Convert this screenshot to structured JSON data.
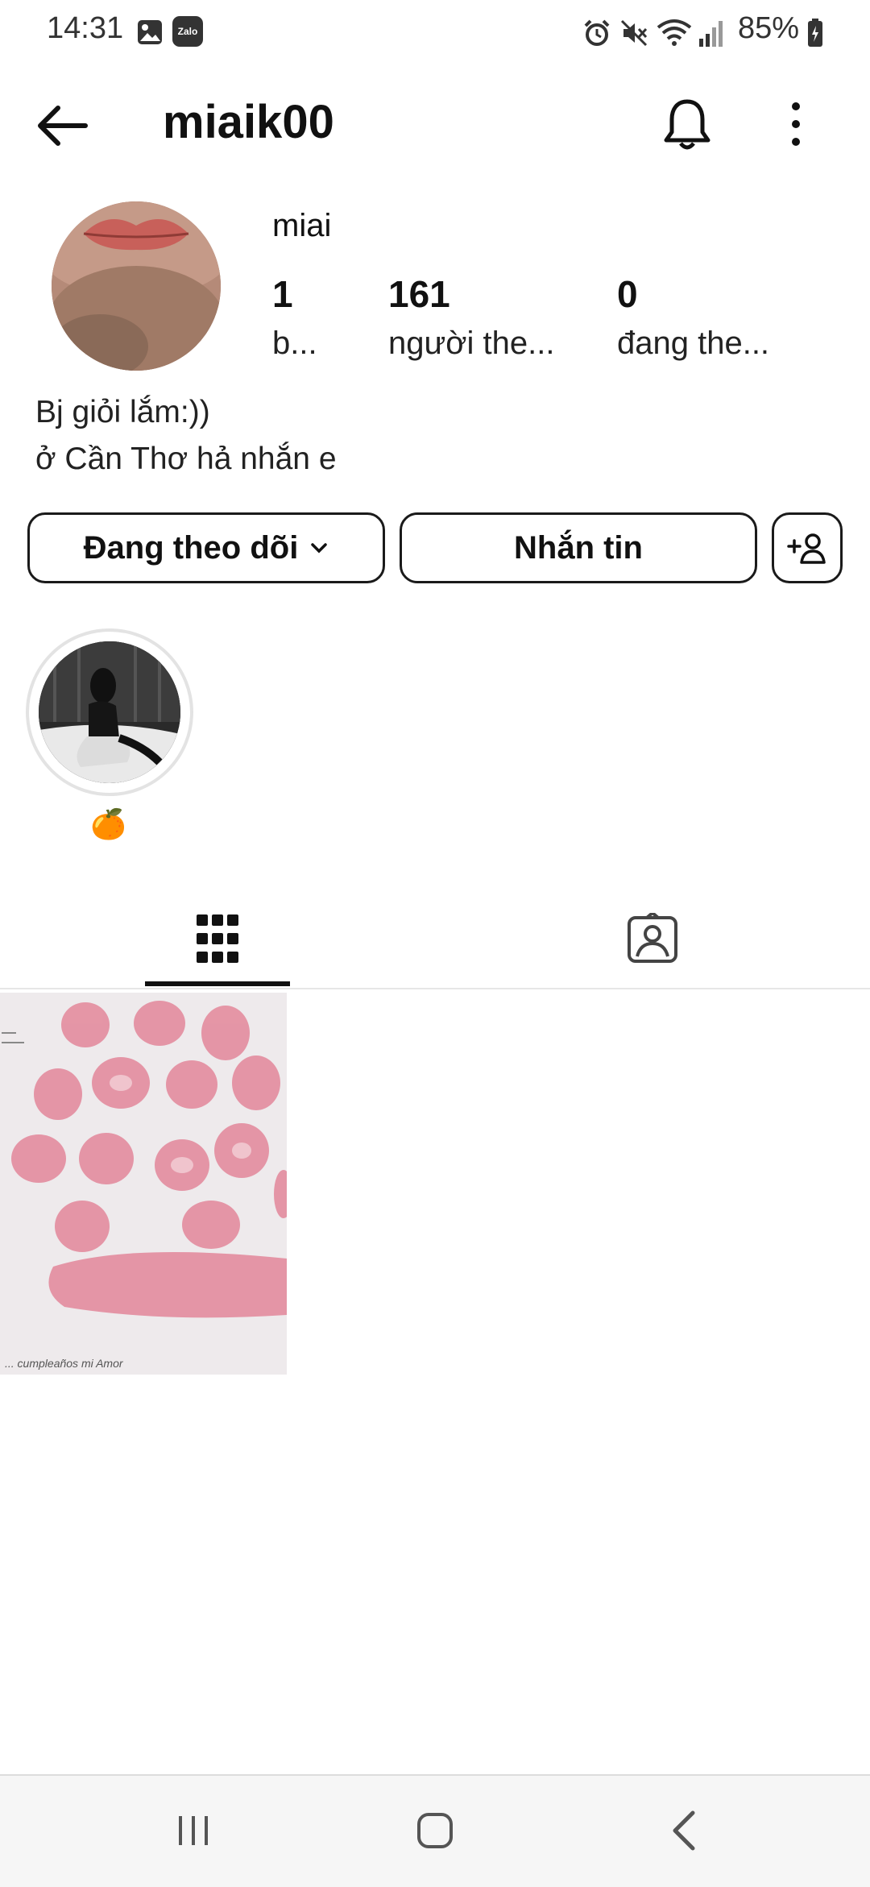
{
  "status_bar": {
    "time": "14:31",
    "battery": "85%",
    "notification_icons": [
      "gallery-icon",
      "zalo-icon"
    ],
    "zalo_badge": "Zalo",
    "system_icons": [
      "alarm-icon",
      "mute-icon",
      "wifi-icon",
      "signal-icon",
      "battery-icon"
    ]
  },
  "header": {
    "username": "miaik00"
  },
  "profile": {
    "display_name": "miai",
    "stats": [
      {
        "value": "1",
        "label": "b..."
      },
      {
        "value": "161",
        "label": "người the..."
      },
      {
        "value": "0",
        "label": "đang the..."
      }
    ],
    "bio_lines": [
      "Bj giỏi lắm:))",
      "ở Cần Thơ hả nhắn e"
    ]
  },
  "actions": {
    "following_label": "Đang theo dõi",
    "message_label": "Nhắn tin"
  },
  "highlights": [
    {
      "label": "🍊"
    }
  ],
  "tabs": [
    "grid-icon",
    "tagged-icon"
  ],
  "posts": [
    {
      "caption": "... cumpleaños mi Amor"
    }
  ],
  "colors": {
    "text": "#111111",
    "border": "#1a1a1a",
    "tab_indicator": "#111111",
    "lip_prints": "#e07b8e"
  }
}
